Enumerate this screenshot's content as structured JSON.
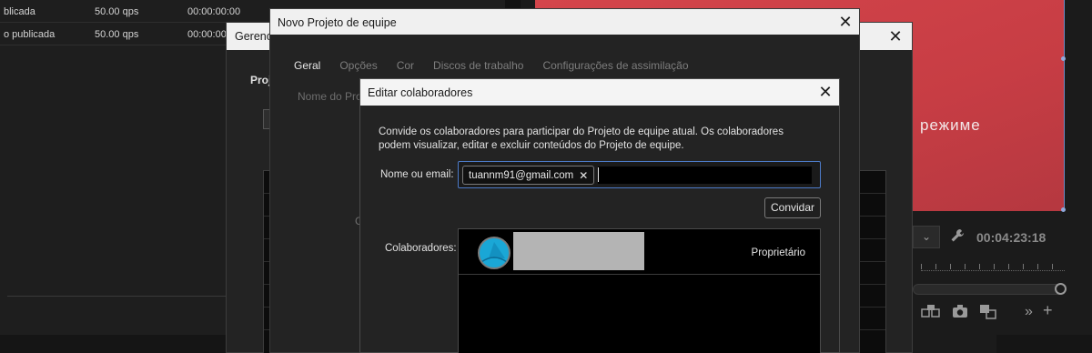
{
  "background": {
    "rows": [
      {
        "name": "blicada",
        "rate": "50.00 qps",
        "time": "00:00:00:00"
      },
      {
        "name": "o publicada",
        "rate": "50.00 qps",
        "time": "00:00:00"
      }
    ],
    "monitor_text": "режиме",
    "timecode": "00:04:23:18",
    "dropdown_glyph": "⌄"
  },
  "dialog_manage": {
    "title": "Gerencia",
    "section_label": "Projo"
  },
  "dialog_new_project": {
    "title": "Novo Projeto de equipe",
    "tabs": [
      "Geral",
      "Opções",
      "Cor",
      "Discos de trabalho",
      "Configurações de assimilação"
    ],
    "active_tab": "Geral",
    "field_label": "Nome do Proje",
    "partial_label": "C"
  },
  "dialog_edit_collaborators": {
    "title": "Editar colaboradores",
    "description": "Convide os colaboradores para participar do Projeto de equipe atual. Os colaboradores podem visualizar, editar e excluir conteúdos do Projeto de equipe.",
    "email_label": "Nome ou email:",
    "chip_email": "tuannm91@gmail.com",
    "chip_remove": "✕",
    "invite_button": "Convidar",
    "collaborators_label": "Colaboradores:",
    "collaborators": [
      {
        "role": "Proprietário"
      }
    ]
  },
  "colors": {
    "accent_focus": "#4d7bc8",
    "avatar": "#1aa7d6",
    "monitor": "#c73d44"
  },
  "icons": [
    "close-icon",
    "remove-chip-icon",
    "avatar-icon",
    "wrench-icon",
    "camera-icon",
    "export-frame-icon",
    "forward-icon",
    "add-icon"
  ]
}
